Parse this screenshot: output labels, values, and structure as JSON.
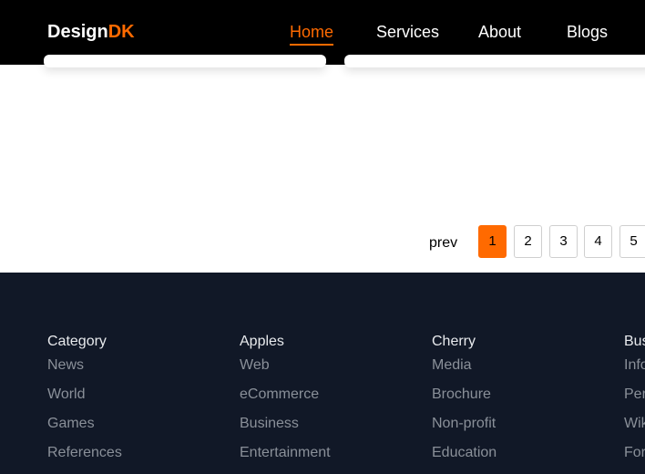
{
  "header": {
    "logo_main": "Design",
    "logo_accent": "DK",
    "nav": [
      "Home",
      "Services",
      "About",
      "Blogs"
    ],
    "active_nav": "Home"
  },
  "pagination": {
    "prev_label": "prev",
    "pages": [
      "1",
      "2",
      "3",
      "4",
      "5"
    ],
    "active_page": "1"
  },
  "footer": {
    "columns": [
      {
        "title": "Category",
        "links": [
          "News",
          "World",
          "Games",
          "References"
        ]
      },
      {
        "title": "Apples",
        "links": [
          "Web",
          "eCommerce",
          "Business",
          "Entertainment"
        ]
      },
      {
        "title": "Cherry",
        "links": [
          "Media",
          "Brochure",
          "Non-profit",
          "Education"
        ]
      },
      {
        "title": "Bus",
        "links": [
          "Info",
          "Per",
          "Wik",
          "For"
        ]
      }
    ]
  },
  "colors": {
    "accent": "#ff6a00",
    "header_bg": "#000000",
    "footer_bg": "#111827"
  }
}
